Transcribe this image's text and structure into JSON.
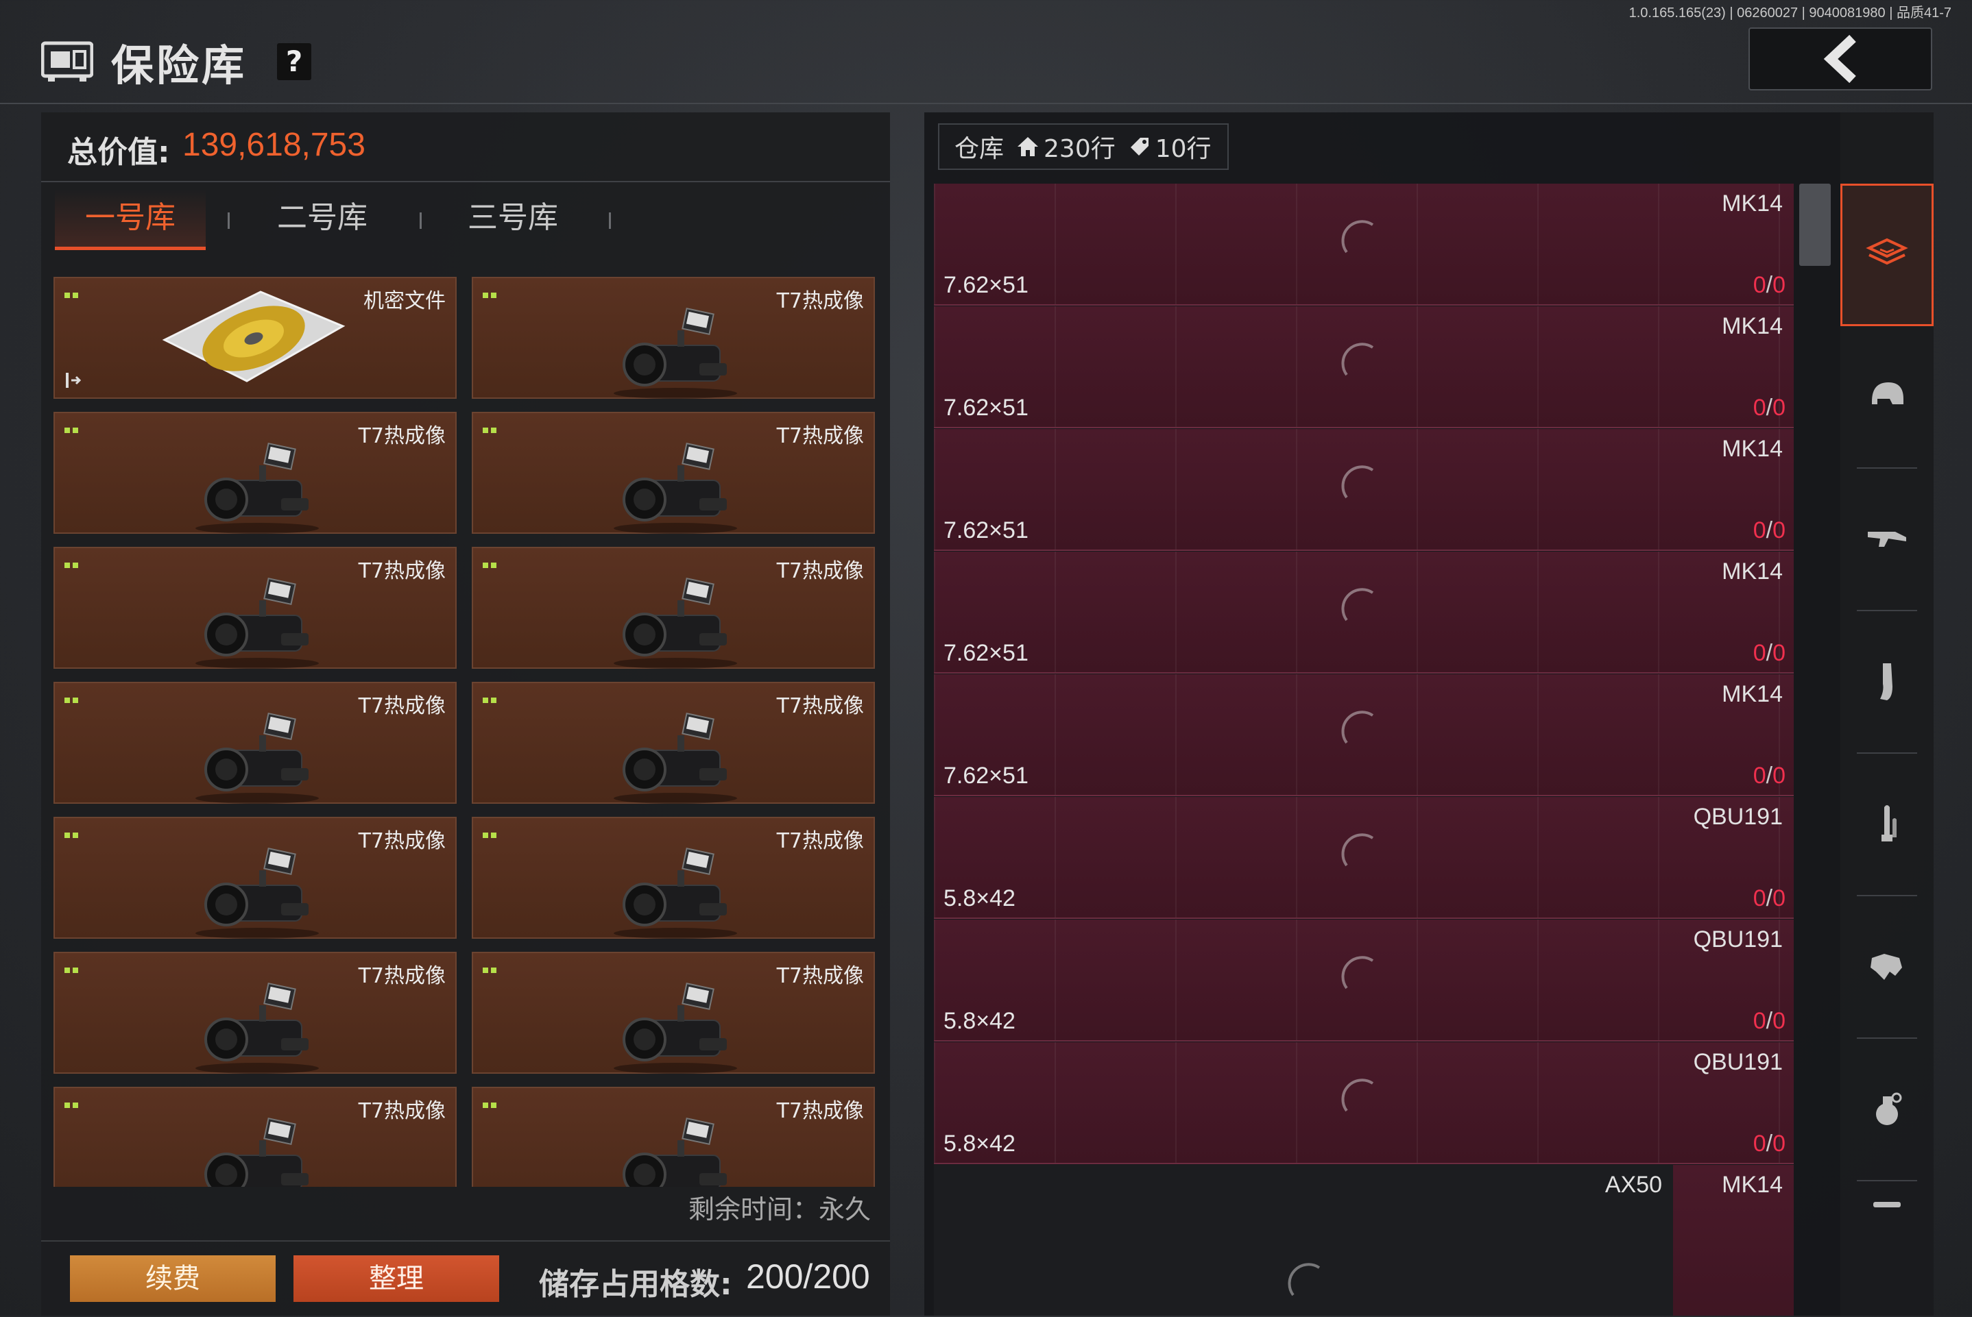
{
  "version": "1.0.165.165(23) | 06260027 | 9040081980 | 品质41-7",
  "header": {
    "title": "保险库",
    "help": "?"
  },
  "total": {
    "label": "总价值:",
    "value": "139,618,753"
  },
  "tabs": [
    {
      "label": "一号库"
    },
    {
      "label": "二号库"
    },
    {
      "label": "三号库"
    }
  ],
  "slots": [
    {
      "label": "机密文件"
    },
    {
      "label": "T7热成像"
    },
    {
      "label": "T7热成像"
    },
    {
      "label": "T7热成像"
    },
    {
      "label": "T7热成像"
    },
    {
      "label": "T7热成像"
    },
    {
      "label": "T7热成像"
    },
    {
      "label": "T7热成像"
    },
    {
      "label": "T7热成像"
    },
    {
      "label": "T7热成像"
    },
    {
      "label": "T7热成像"
    },
    {
      "label": "T7热成像"
    },
    {
      "label": "T7热成像"
    },
    {
      "label": "T7热成像"
    }
  ],
  "remain": "剩余时间：永久",
  "bottom": {
    "renew": "续费",
    "sort": "整理",
    "storage_label": "储存占用格数:",
    "storage_value": "200/200"
  },
  "warehouse": {
    "label": "仓库",
    "rows_home": "230行",
    "rows_tag": "10行"
  },
  "wh_rows": [
    {
      "weapon": "MK14",
      "caliber": "7.62×51",
      "count_a": "0",
      "count_b": "0"
    },
    {
      "weapon": "MK14",
      "caliber": "7.62×51",
      "count_a": "0",
      "count_b": "0"
    },
    {
      "weapon": "MK14",
      "caliber": "7.62×51",
      "count_a": "0",
      "count_b": "0"
    },
    {
      "weapon": "MK14",
      "caliber": "7.62×51",
      "count_a": "0",
      "count_b": "0"
    },
    {
      "weapon": "MK14",
      "caliber": "7.62×51",
      "count_a": "0",
      "count_b": "0"
    },
    {
      "weapon": "QBU191",
      "caliber": "5.8×42",
      "count_a": "0",
      "count_b": "0"
    },
    {
      "weapon": "QBU191",
      "caliber": "5.8×42",
      "count_a": "0",
      "count_b": "0"
    },
    {
      "weapon": "QBU191",
      "caliber": "5.8×42",
      "count_a": "0",
      "count_b": "0"
    }
  ],
  "wh_last": {
    "left_weapon": "AX50",
    "right_weapon": "MK14"
  },
  "categories": [
    "all-items-icon",
    "helmet-icon",
    "rifle-icon",
    "magazine-icon",
    "ammo-icon",
    "armor-icon",
    "grenade-icon",
    "more-icon"
  ],
  "colors": {
    "accent": "#e8502a",
    "value": "#f0622e",
    "count_red": "#f0304e"
  }
}
